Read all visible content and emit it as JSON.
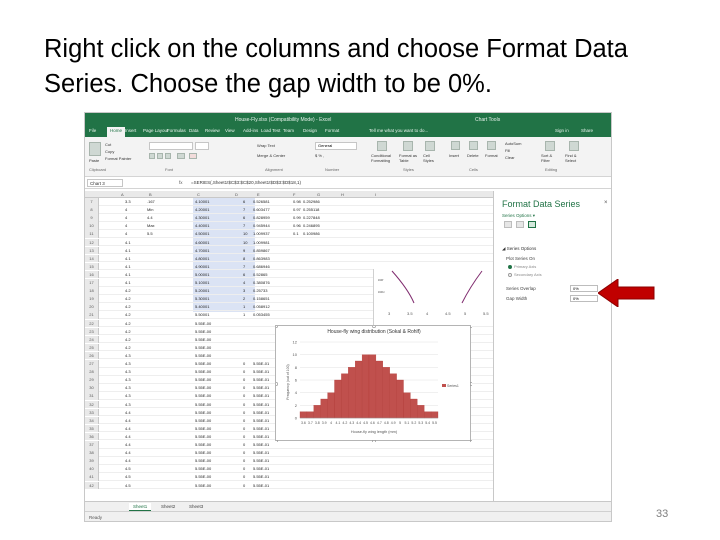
{
  "slide": {
    "title": "Right click on the columns and choose Format Data Series. Choose the gap width to be 0%.",
    "number": "33"
  },
  "excel": {
    "window_title": "House-Fly.xlsx (Compatibility Mode) - Excel",
    "context_label": "Chart Tools",
    "tabs": [
      "File",
      "Home",
      "Insert",
      "Page Layout",
      "Formulas",
      "Data",
      "Review",
      "View",
      "Add-ins",
      "Load Test",
      "Team",
      "Design",
      "Format"
    ],
    "active_tab": "Home",
    "tell_me": "Tell me what you want to do...",
    "signin": "Sign in",
    "share": "Share",
    "ribbon": {
      "paste": "Paste",
      "cut": "Cut",
      "copy": "Copy",
      "format_painter": "Format Painter",
      "wrap_text": "Wrap Text",
      "merge_center": "Merge & Center",
      "number_format": "General",
      "conditional_formatting": "Conditional Formatting",
      "format_as_table": "Format as Table",
      "cell_styles": "Cell Styles",
      "insert": "Insert",
      "delete": "Delete",
      "format": "Format",
      "autosum": "AutoSum",
      "fill": "Fill",
      "clear": "Clear",
      "sort_filter": "Sort & Filter",
      "find_select": "Find & Select",
      "groups": [
        "Clipboard",
        "Font",
        "Alignment",
        "Number",
        "Styles",
        "Cells",
        "Editing"
      ]
    },
    "name_box": "Chart 3",
    "fx": "fx",
    "formula": "=SERIES(,Sheet1!$C$3:$C$20,Sheet1!$D$3:$D$18,1)",
    "columns": [
      "A",
      "B",
      "C",
      "D",
      "E",
      "F",
      "G",
      "H",
      "I"
    ],
    "rows": [
      {
        "n": "7",
        "a": "3.3",
        "b": ".167",
        "c": "4.10001",
        "d": "6",
        "e": "0.526581",
        "f": "0.98",
        "g": "0.252986"
      },
      {
        "n": "8",
        "a": "4",
        "b": "Min",
        "c": "4.20001",
        "d": "7",
        "e": "0.603477",
        "f": "0.97",
        "g": "0.255118"
      },
      {
        "n": "9",
        "a": "4",
        "b": "4.4",
        "c": "4.30001",
        "d": "6",
        "e": "0.828959",
        "f": "0.99",
        "g": "0.227848"
      },
      {
        "n": "10",
        "a": "4",
        "b": "Max",
        "c": "4.40001",
        "d": "7",
        "e": "0.945944",
        "f": "0.96",
        "g": "0.246895"
      },
      {
        "n": "11",
        "a": "4",
        "b": "5.5",
        "c": "4.50001",
        "d": "10",
        "e": "1.009937",
        "f": "0.1",
        "g": "0.100986"
      },
      {
        "n": "12",
        "a": "4.1",
        "b": "",
        "c": "4.60001",
        "d": "10",
        "e": "1.009981",
        "f": "",
        "g": ""
      },
      {
        "n": "13",
        "a": "4.1",
        "b": "",
        "c": "4.70001",
        "d": "9",
        "e": "0.859867",
        "f": "",
        "g": ""
      },
      {
        "n": "14",
        "a": "4.1",
        "b": "",
        "c": "4.80001",
        "d": "8",
        "e": "0.863983",
        "f": "",
        "g": ""
      },
      {
        "n": "15",
        "a": "4.1",
        "b": "",
        "c": "4.90001",
        "d": "7",
        "e": "0.686946",
        "f": "",
        "g": ""
      },
      {
        "n": "16",
        "a": "4.1",
        "b": "",
        "c": "5.00001",
        "d": "6",
        "e": "0.52865",
        "f": "",
        "g": ""
      },
      {
        "n": "17",
        "a": "4.1",
        "b": "",
        "c": "5.10001",
        "d": "4",
        "e": "0.380876",
        "f": "",
        "g": ""
      },
      {
        "n": "18",
        "a": "4.2",
        "b": "",
        "c": "5.20001",
        "d": "3",
        "e": "0.25733",
        "f": "",
        "g": ""
      },
      {
        "n": "19",
        "a": "4.2",
        "b": "",
        "c": "5.30001",
        "d": "2",
        "e": "0.158651",
        "f": "",
        "g": ""
      },
      {
        "n": "20",
        "a": "4.2",
        "b": "",
        "c": "5.40001",
        "d": "1",
        "e": "0.058912",
        "f": "",
        "g": ""
      },
      {
        "n": "21",
        "a": "4.2",
        "b": "",
        "c": "5.50001",
        "d": "1",
        "e": "0.053455",
        "f": "",
        "g": ""
      },
      {
        "n": "22",
        "a": "4.2",
        "b": "",
        "c": "5.55E-00",
        "d": "",
        "e": "",
        "f": "",
        "g": ""
      },
      {
        "n": "23",
        "a": "4.2",
        "b": "",
        "c": "5.55E-00",
        "d": "",
        "e": "",
        "f": "",
        "g": ""
      },
      {
        "n": "24",
        "a": "4.2",
        "b": "",
        "c": "5.55E-00",
        "d": "",
        "e": "",
        "f": "",
        "g": ""
      },
      {
        "n": "25",
        "a": "4.2",
        "b": "",
        "c": "5.55E-00",
        "d": "",
        "e": "",
        "f": "",
        "g": ""
      },
      {
        "n": "26",
        "a": "4.3",
        "b": "",
        "c": "5.55E-00",
        "d": "",
        "e": "",
        "f": "",
        "g": ""
      },
      {
        "n": "27",
        "a": "4.3",
        "b": "",
        "c": "5.55E-00",
        "d": "0",
        "e": "5.55E-01",
        "f": "",
        "g": ""
      },
      {
        "n": "28",
        "a": "4.3",
        "b": "",
        "c": "5.55E-00",
        "d": "0",
        "e": "5.55E-01",
        "f": "",
        "g": ""
      },
      {
        "n": "29",
        "a": "4.3",
        "b": "",
        "c": "5.55E-00",
        "d": "0",
        "e": "5.55E-01",
        "f": "",
        "g": ""
      },
      {
        "n": "30",
        "a": "4.3",
        "b": "",
        "c": "5.55E-00",
        "d": "0",
        "e": "5.55E-01",
        "f": "",
        "g": ""
      },
      {
        "n": "31",
        "a": "4.3",
        "b": "",
        "c": "5.55E-00",
        "d": "0",
        "e": "5.55E-01",
        "f": "",
        "g": ""
      },
      {
        "n": "32",
        "a": "4.3",
        "b": "",
        "c": "5.55E-00",
        "d": "0",
        "e": "5.55E-01",
        "f": "",
        "g": ""
      },
      {
        "n": "33",
        "a": "4.4",
        "b": "",
        "c": "5.55E-00",
        "d": "0",
        "e": "5.55E-01",
        "f": "",
        "g": ""
      },
      {
        "n": "34",
        "a": "4.4",
        "b": "",
        "c": "5.55E-00",
        "d": "0",
        "e": "5.55E-01",
        "f": "",
        "g": ""
      },
      {
        "n": "35",
        "a": "4.4",
        "b": "",
        "c": "5.55E-00",
        "d": "0",
        "e": "5.55E-01",
        "f": "",
        "g": ""
      },
      {
        "n": "36",
        "a": "4.4",
        "b": "",
        "c": "5.55E-00",
        "d": "0",
        "e": "5.55E-01",
        "f": "",
        "g": ""
      },
      {
        "n": "37",
        "a": "4.4",
        "b": "",
        "c": "5.55E-00",
        "d": "0",
        "e": "5.55E-01",
        "f": "",
        "g": ""
      },
      {
        "n": "38",
        "a": "4.4",
        "b": "",
        "c": "5.55E-00",
        "d": "0",
        "e": "5.55E-01",
        "f": "",
        "g": ""
      },
      {
        "n": "39",
        "a": "4.4",
        "b": "",
        "c": "5.55E-00",
        "d": "0",
        "e": "5.55E-01",
        "f": "",
        "g": ""
      },
      {
        "n": "40",
        "a": "4.5",
        "b": "",
        "c": "5.55E-00",
        "d": "0",
        "e": "5.55E-01",
        "f": "",
        "g": ""
      },
      {
        "n": "41",
        "a": "4.5",
        "b": "",
        "c": "5.55E-00",
        "d": "0",
        "e": "5.55E-01",
        "f": "",
        "g": ""
      },
      {
        "n": "42",
        "a": "4.5",
        "b": "",
        "c": "5.55E-00",
        "d": "0",
        "e": "5.55E-01",
        "f": "",
        "g": ""
      }
    ],
    "top_chart": {
      "ticks": [
        "3",
        "3.5",
        "4",
        "4.5",
        "5",
        "5.5"
      ],
      "labels": [
        "cor",
        "cou"
      ]
    },
    "chart_data": {
      "type": "bar",
      "title": "House-fly wing distribution (Sokal & Rohlf)",
      "xlabel": "House-fly wing length (mm)",
      "ylabel": "Frequency (out of 100)",
      "legend": "Series1",
      "legend_position": "right",
      "grid": true,
      "bar_color": "#c0504d",
      "ylim": [
        0,
        12
      ],
      "yticks": [
        "0",
        "2",
        "4",
        "6",
        "8",
        "10",
        "12"
      ],
      "categories": [
        "3.6",
        "3.7",
        "3.8",
        "3.9",
        "4",
        "4.1",
        "4.2",
        "4.3",
        "4.4",
        "4.5",
        "4.6",
        "4.7",
        "4.8",
        "4.9",
        "5",
        "5.1",
        "5.2",
        "5.3",
        "5.4",
        "5.5"
      ],
      "values": [
        1,
        1,
        2,
        3,
        4,
        6,
        7,
        8,
        9,
        10,
        10,
        9,
        8,
        7,
        6,
        4,
        3,
        2,
        1,
        1
      ]
    },
    "pane": {
      "title": "Format Data Series",
      "close": "×",
      "options_label": "Series Options ▾",
      "section": "◢ Series Options",
      "plot_series_on": "Plot Series On",
      "primary_axis": "Primary Axis",
      "secondary_axis": "Secondary Axis",
      "series_overlap_label": "Series Overlap",
      "series_overlap_value": "0%",
      "gap_width_label": "Gap Width",
      "gap_width_value": "0%"
    },
    "sheet_tabs": [
      "Sheet1",
      "Sheet2",
      "Sheet3"
    ],
    "active_sheet": "Sheet1",
    "status": "Ready"
  },
  "annotation": {
    "arrow_color": "#c00000"
  }
}
